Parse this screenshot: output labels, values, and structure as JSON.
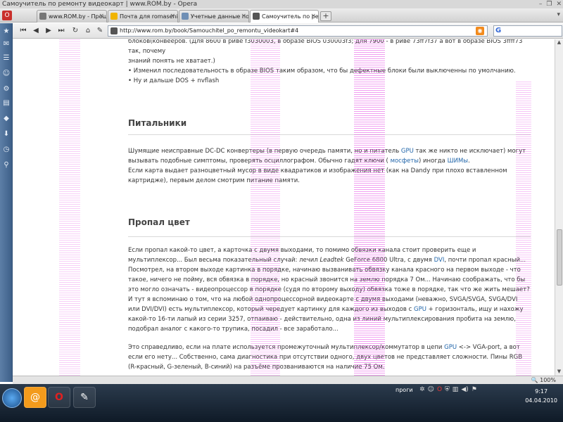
{
  "window": {
    "title": "Самоучитель по ремонту видеокарт | www.ROM.by - Opera",
    "controls": [
      "–",
      "❐",
      "✕"
    ]
  },
  "tabs": [
    {
      "label": "www.ROM.by - Прошу...",
      "active": false
    },
    {
      "label": "Почта для romasenin...",
      "active": false
    },
    {
      "label": "Учетные данные поль...",
      "active": false
    },
    {
      "label": "Самоучитель по ремо...",
      "active": true
    }
  ],
  "address": {
    "url": "http://www.rom.by/book/Samouchitel_po_remontu_videokart#4"
  },
  "article": {
    "intro_lines": [
      "блоков(конвееров. (Для 8600 в риве f3030003, в образе BIOS 030003f3; для 7900 - в риве 73ff7f37 а вот в образе BIOS 3ffff73 так, почему",
      "знаний понять не хватает.)"
    ],
    "bullets": [
      "Изменил последовательность в образе BIOS таким образом, что бы дефектные блоки были выключенны по умолчанию.",
      "Ну и дальше DOS + nvflash"
    ],
    "section1": {
      "heading": "Питальники",
      "p1_a": "Шумящие неисправные DC-DC конвертеры (в первую очередь памяти, но и питатель ",
      "p1_gpu": "GPU",
      "p1_b": " так же никто не исключает) могут вызывать подобные симптомы, проверять осциллографом. Обычно гадят ключи ( ",
      "p1_mosfet": "мосфеты",
      "p1_c": ") иногда ",
      "p1_shim": "ШИМы",
      "p1_d": ".",
      "p2": "Если карта выдает разноцветный мусор в виде квадратиков и изображения нет (как на Dandy при плохо вставленном картридже), первым делом смотрим питание памяти."
    },
    "section2": {
      "heading": "Пропал цвет",
      "p1_a": "Если пропал какой-то цвет, а карточка с двумя выходами, то помимо обвязки канала стоит проверить еще и мультиплексор... Был весьма показательный случай: лечил ",
      "p1_leadtek": "Leadtek",
      "p1_b": " GeForce 6800 Ultra, с двумя ",
      "p1_dvi": "DVI",
      "p1_c": ", почти пропал красный... Посмотрел, на втором выходе картинка в порядке, начинаю вызванивать обвязку канала красного на первом выходе - что такое, ничего не пойму, вся обвязка в порядке, но красный звонится на землю порядка 7 Ом... Начинаю соображать, что бы это могло означать - видеопроцессор в порядке (судя по второму выходу) обвязка тоже в порядке, так что же жить мешает? И тут я вспоминаю о том, что на любой однопроцессорной видеокарте с двумя выходами (неважно, SVGA/SVGA, SVGA/DVI или DVI/DVI) есть мультиплексор, который чередует картинку для каждого из выходов с ",
      "p1_gpu": "GPU",
      "p1_d": " + горизонталь, ищу и нахожу какой-то 16-ти лапый из серии 3257, отпаиваю - действительно, одна из линий мультиплексирования пробита на землю, подобрал аналог с какого-то трупика, посадил - все заработало...",
      "p2_a": "Это справедливо, если на плате используется промежуточный мультиплексор/коммутатор в цепи ",
      "p2_gpu": "GPU",
      "p2_b": " <-> VGA-port, а вот если его нету... Собственно, сама диагностика при отсутствии одного, двух цветов не представляет сложности. Пины RGB (R-красный, G-зеленый, B-синий) на разъёме прозваниваются на наличие 75 Ом."
    }
  },
  "statusbar": {
    "zoom": "100%"
  },
  "taskbar": {
    "tray_label": "проги",
    "time": "9:17",
    "date": "04.04.2010"
  },
  "colors": {
    "link": "#2266aa",
    "sidebar": "#4a6d96",
    "opera_red": "#c9302c"
  }
}
